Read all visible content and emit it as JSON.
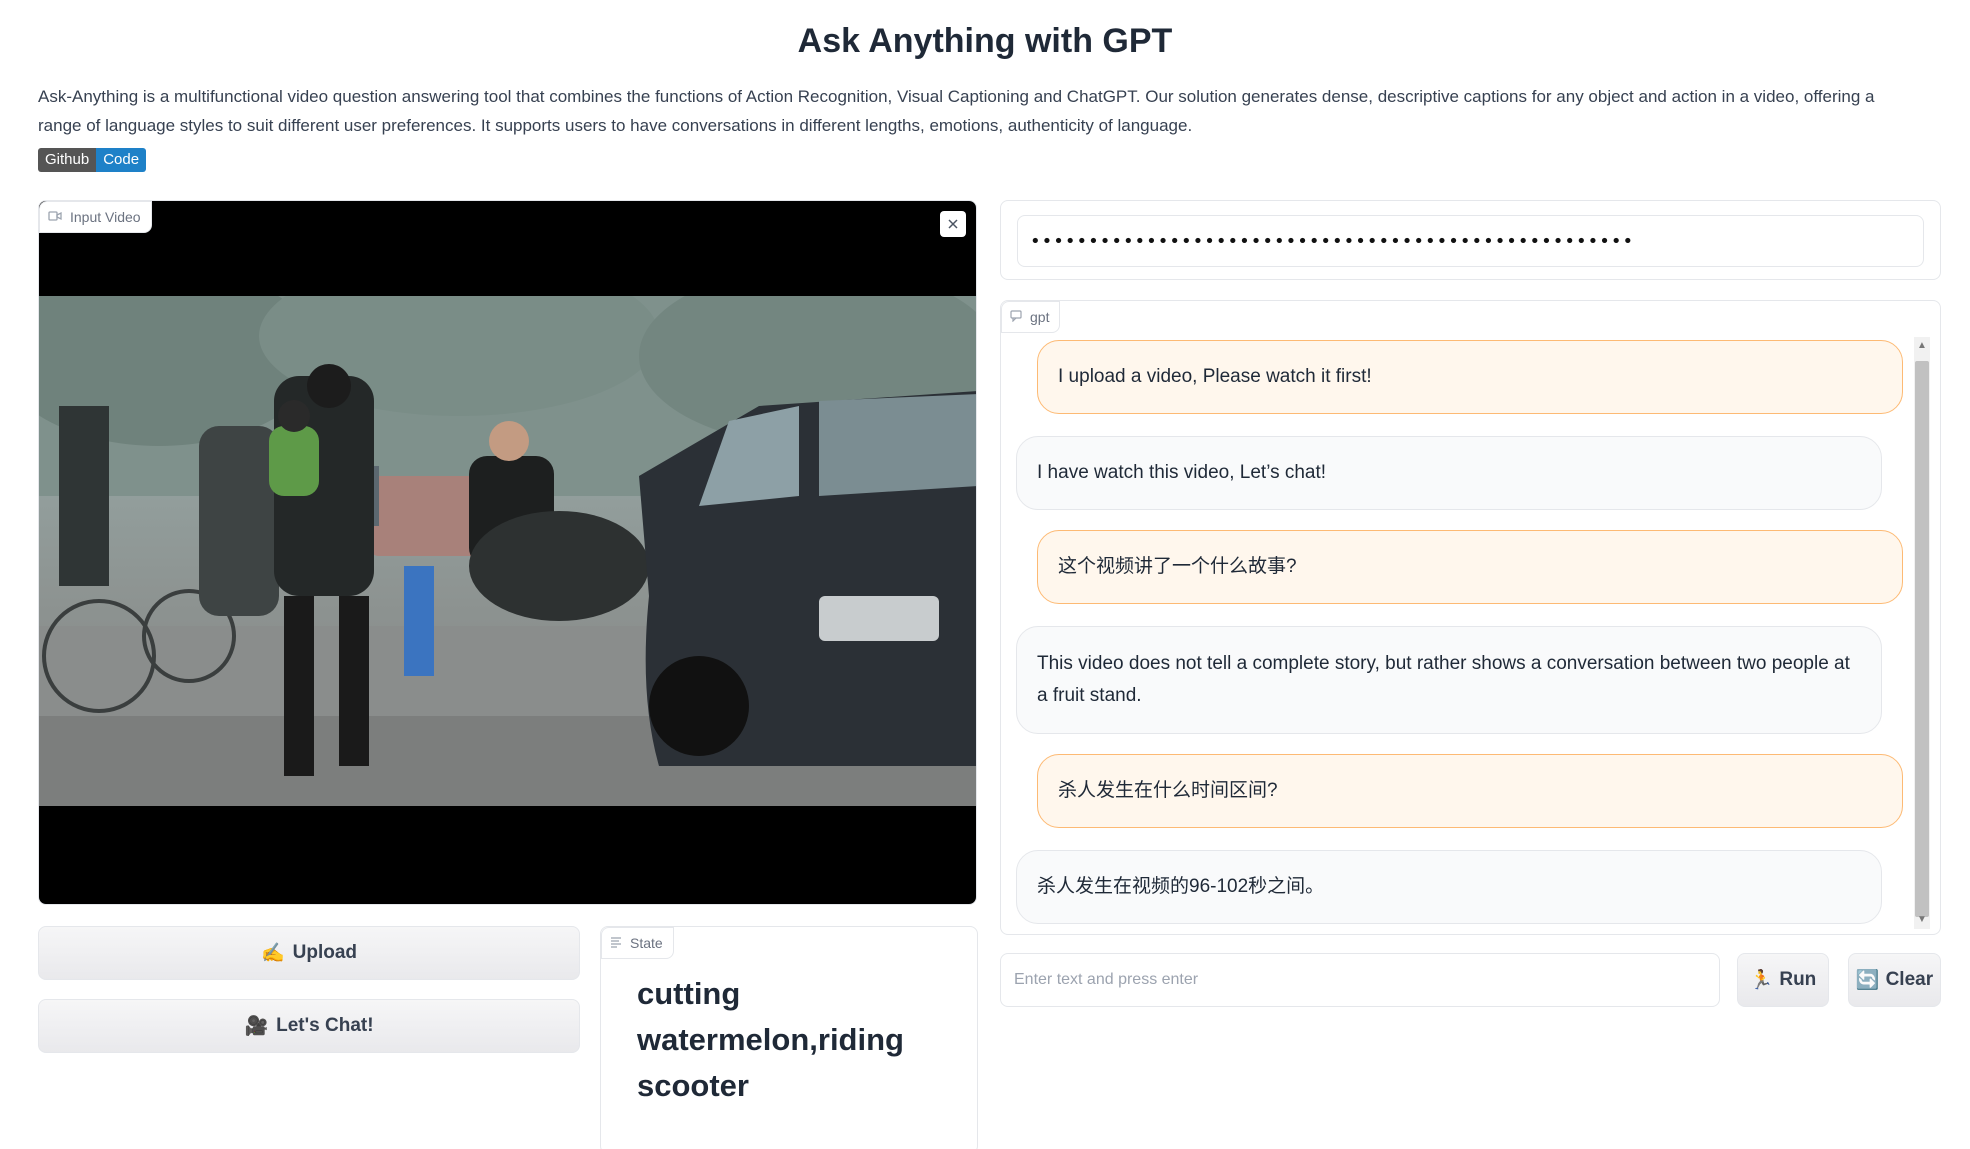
{
  "header": {
    "title": "Ask Anything with GPT",
    "description": "Ask-Anything is a multifunctional video question answering tool that combines the functions of Action Recognition, Visual Captioning and ChatGPT. Our solution generates dense, descriptive captions for any object and action in a video, offering a range of language styles to suit different user preferences. It supports users to have conversations in different lengths, emotions, authenticity of language.",
    "badge_left": "Github",
    "badge_right": "Code"
  },
  "video": {
    "label": "Input Video",
    "label_icon": "video-camera-icon",
    "close_icon": "close-icon"
  },
  "buttons": {
    "upload_icon": "✍️",
    "upload_label": "Upload",
    "chat_icon": "🎥",
    "chat_label": "Let's Chat!"
  },
  "state": {
    "label": "State",
    "label_icon": "text-icon",
    "value": "cutting watermelon,riding scooter"
  },
  "api_key": {
    "value": "••••••••••••••••••••••••••••••••••••••••••••••••••••"
  },
  "chat": {
    "label": "gpt",
    "label_icon": "chat-bubble-icon",
    "messages": [
      {
        "role": "user",
        "text": "I upload a video, Please watch it first!"
      },
      {
        "role": "bot",
        "text": "I have watch this video, Let’s chat!"
      },
      {
        "role": "user",
        "text": "这个视频讲了一个什么故事?"
      },
      {
        "role": "bot",
        "text": "This video does not tell a complete story, but rather shows a conversation between two people at a fruit stand."
      },
      {
        "role": "user",
        "text": "杀人发生在什么时间区间?"
      },
      {
        "role": "bot",
        "text": "杀人发生在视频的96-102秒之间。"
      }
    ]
  },
  "input": {
    "placeholder": "Enter text and press enter",
    "run_icon": "🏃",
    "run_label": "Run",
    "clear_icon": "🔄",
    "clear_label": "Clear"
  }
}
